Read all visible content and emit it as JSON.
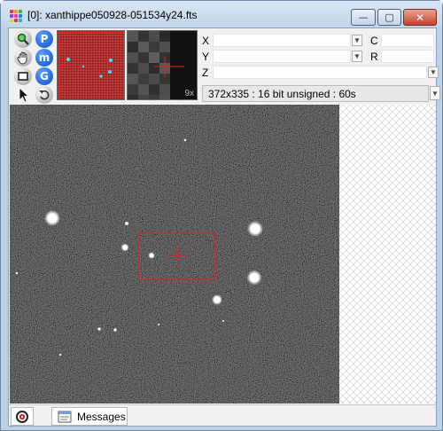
{
  "window": {
    "title": "[0]: xanthippe050928-051534y24.fts",
    "min_glyph": "—",
    "max_glyph": "▢",
    "close_glyph": "✕"
  },
  "toolbar": {
    "zoom_icon": "magnifier-icon",
    "pan_icon": "hand-icon",
    "rect_icon": "rectangle-select-icon",
    "arrow_icon": "pointer-arrow-icon",
    "p_label": "P",
    "m_label": "m",
    "g_label": "G",
    "reset_icon": "undo-icon"
  },
  "magnifier": {
    "zoom_label": "9x"
  },
  "coords": {
    "x_label": "X",
    "x_value": "",
    "c_label": "C",
    "c_value": "",
    "y_label": "Y",
    "y_value": "",
    "r_label": "R",
    "r_value": "",
    "z_label": "Z",
    "z_value": ""
  },
  "info": {
    "text": "372x335 : 16 bit unsigned : 60s"
  },
  "tabs": [
    {
      "icon": "target-icon"
    },
    {
      "icon": "messages-icon",
      "label": "Messages"
    }
  ],
  "colors": {
    "accent_red": "#dd2222",
    "marker_cyan": "#33e6ff"
  }
}
